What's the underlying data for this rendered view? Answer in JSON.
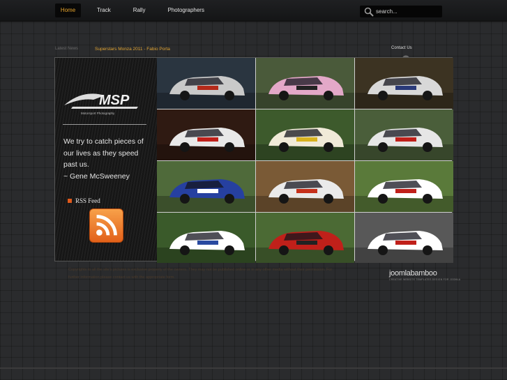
{
  "nav": {
    "items": [
      {
        "label": "Home",
        "active": true
      },
      {
        "label": "Track",
        "active": false
      },
      {
        "label": "Rally",
        "active": false
      },
      {
        "label": "Photographers",
        "active": false
      }
    ]
  },
  "search": {
    "placeholder": "search..."
  },
  "latest": {
    "label": "Latest News",
    "title": "Superstars Monza 2011 - Fabio Porta"
  },
  "contact": {
    "label": "Contact Us"
  },
  "sidebar": {
    "logo_text": "MSP",
    "logo_sub": "Motorsport Photography",
    "quote_lines": [
      "We try to catch pieces of",
      "our lives as they speed",
      "past us.",
      "~ Gene McSweeney"
    ],
    "rss_label": "RSS Feed"
  },
  "gallery": {
    "tiles": [
      {
        "icon": "race-car-photo",
        "bg": "#2a3540",
        "car": "#c9c9c9",
        "accent": "#b52a1a"
      },
      {
        "icon": "race-car-photo",
        "bg": "#4a5a3a",
        "car": "#e3a8c8",
        "accent": "#222"
      },
      {
        "icon": "rally-car-photo",
        "bg": "#3c3322",
        "car": "#d8d8d8",
        "accent": "#2a3a7a"
      },
      {
        "icon": "race-car-photo",
        "bg": "#2f1a12",
        "car": "#e8e8e8",
        "accent": "#c0201a"
      },
      {
        "icon": "race-car-photo",
        "bg": "#3d5a2c",
        "car": "#f0ead8",
        "accent": "#d8b21e"
      },
      {
        "icon": "race-car-photo",
        "bg": "#4a5e3a",
        "car": "#e6e6e6",
        "accent": "#c0201a"
      },
      {
        "icon": "race-car-photo",
        "bg": "#4f6a3a",
        "car": "#2640a0",
        "accent": "#ffffff"
      },
      {
        "icon": "rally-car-photo",
        "bg": "#7a5a36",
        "car": "#eaeaea",
        "accent": "#c6301a"
      },
      {
        "icon": "race-car-photo",
        "bg": "#5a7a3a",
        "car": "#ffffff",
        "accent": "#c0201a"
      },
      {
        "icon": "rally-car-photo",
        "bg": "#3a5a2a",
        "car": "#ffffff",
        "accent": "#2a4aa0"
      },
      {
        "icon": "race-car-photo",
        "bg": "#4b6a34",
        "car": "#c0201a",
        "accent": "#222"
      },
      {
        "icon": "race-car-photo",
        "bg": "#585858",
        "car": "#ffffff",
        "accent": "#c0201a"
      }
    ]
  },
  "footer": {
    "text": "Copyrights to all the site's pictures is exclusive property of the owners. They may not be published online or in any other media without their permission. For further information please contact us with the appropriate form.",
    "brand": "joomlabamboo",
    "brand_sub": "CREATIVE WEBSITE TEMPLATES DESIGN FOR JOOMLA"
  }
}
